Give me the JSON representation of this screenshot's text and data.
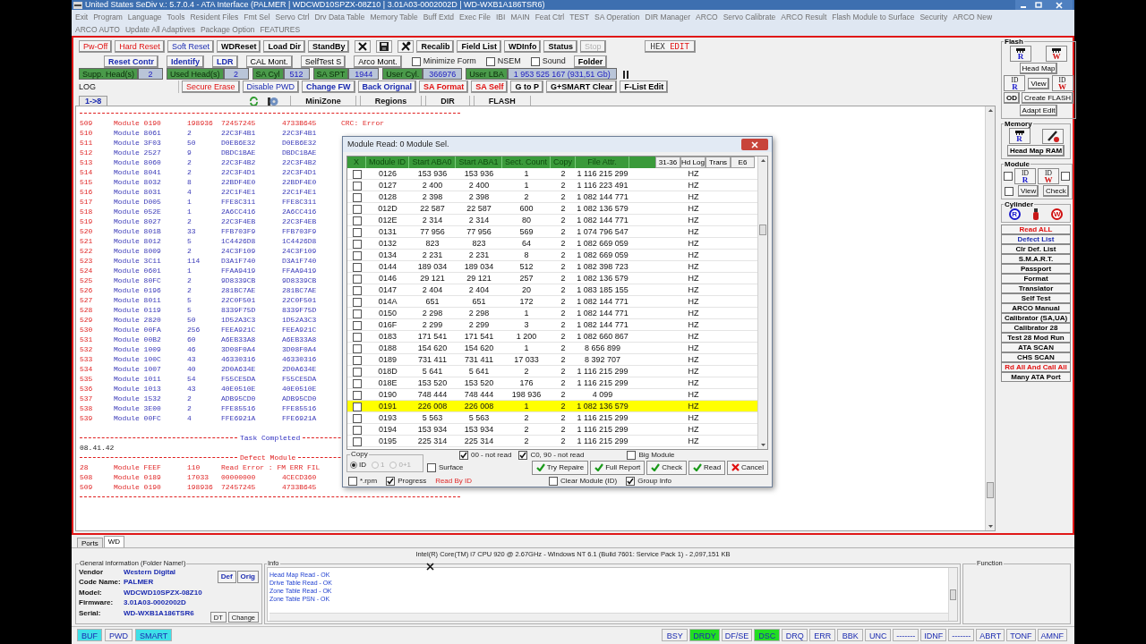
{
  "window": {
    "title": "United States  SeDiv v.: 5.7.0.4 - ATA Interface  (PALMER | WDCWD10SPZX-08Z10 | 3.01A03-0002002D | WD-WXB1A186TSR6)"
  },
  "menu": {
    "first_line": [
      "Exit",
      "Program",
      "Language",
      "Tools",
      "Resident Files",
      "Fmt Sel",
      "Servo Ctrl",
      "Drv Data Table",
      "Memory Table",
      "Buff Extd",
      "Exec File",
      "IBI",
      "MAIN",
      "Feat Ctrl",
      "TEST",
      "SA Operation",
      "DIR Manager",
      "ARCO",
      "Servo Calibrate",
      "ARCO Result",
      "Flash Module to Surface",
      "Security",
      "ARCO New"
    ],
    "second_line": [
      "ARCO AUTO",
      "Update All Adaptives",
      "Package Option",
      "FEATURES"
    ]
  },
  "toolbar": {
    "power_row": [
      {
        "kind": "alert-button",
        "label": "Pw-Off",
        "disabled": false
      },
      {
        "kind": "alert-button",
        "label": "Hard Reset",
        "disabled": false
      },
      {
        "kind": "accent-button",
        "label": "Soft Reset",
        "disabled": false
      },
      {
        "kind": "bold-button",
        "label": "WDReset",
        "disabled": false
      },
      {
        "kind": "bold-button",
        "label": "Load Dir",
        "disabled": false
      },
      {
        "kind": "bold-button",
        "label": "StandBy",
        "disabled": false
      },
      {
        "kind": "x-tool",
        "disabled": false
      },
      {
        "kind": "save-tool",
        "disabled": false
      },
      {
        "kind": "wrench-tool",
        "disabled": false
      },
      {
        "kind": "bold-button",
        "label": "Recalib",
        "disabled": false
      },
      {
        "kind": "bold-button",
        "label": "Field List",
        "disabled": false
      },
      {
        "kind": "bold-button",
        "label": "WDInfo",
        "disabled": false
      },
      {
        "kind": "bold-button",
        "label": "Status",
        "disabled": false
      },
      {
        "kind": "button",
        "label": "Stop",
        "disabled": true
      },
      {
        "kind": "hex",
        "parts": [
          "HEX",
          "EDIT"
        ],
        "disabled": false
      }
    ],
    "control_row": [
      {
        "kind": "bold-accent-button",
        "label": "Reset Contr"
      },
      {
        "kind": "bold-accent-button",
        "label": "Identify"
      },
      {
        "kind": "bold-accent-button",
        "label": "LDR"
      },
      {
        "kind": "button",
        "label": "CAL Mont."
      },
      {
        "kind": "button",
        "label": "SelfTest S"
      },
      {
        "kind": "button",
        "label": "Arco Mont."
      },
      {
        "kind": "check",
        "label": "Minimize Form",
        "checked": false
      },
      {
        "kind": "check",
        "label": "NSEM",
        "checked": false
      },
      {
        "kind": "check",
        "label": "Sound",
        "checked": false
      },
      {
        "kind": "bold-button",
        "label": "Folder"
      }
    ],
    "readout_row": [
      {
        "kind": "readout",
        "label": "Supp. Head(s)",
        "value": "2"
      },
      {
        "kind": "readout",
        "label": "Used Head(s)",
        "value": "2"
      },
      {
        "kind": "readout",
        "label": "SA Cyl",
        "value": "512"
      },
      {
        "kind": "readout",
        "label": "SA SPT",
        "value": "1944"
      },
      {
        "kind": "readout",
        "label": "User Cyl.",
        "value": "366976"
      },
      {
        "kind": "readout",
        "label": "User LBA",
        "value": "1 953 525 167  (931,51 Gb)"
      },
      {
        "kind": "splitter"
      }
    ],
    "log_row": [
      {
        "kind": "label",
        "text": "LOG"
      },
      {
        "kind": "alert-button",
        "label": "Secure Erase"
      },
      {
        "kind": "accent-button",
        "label": "Disable PWD"
      },
      {
        "kind": "bold-accent-button",
        "label": "Change FW"
      },
      {
        "kind": "bold-accent-button",
        "label": "Back Orignal"
      },
      {
        "kind": "bold-alert-button",
        "label": "SA Format"
      },
      {
        "kind": "bold-alert-button",
        "label": "SA Self"
      },
      {
        "kind": "bold-button",
        "label": "G to P"
      },
      {
        "kind": "bold-button",
        "label": "G+SMART Clear"
      },
      {
        "kind": "bold-button",
        "label": "F-List Edit"
      }
    ],
    "view_row": [
      {
        "kind": "tab",
        "label": "1->8"
      },
      {
        "kind": "refresh-tool"
      },
      {
        "kind": "disk-tool"
      },
      {
        "kind": "segment",
        "label": "MiniZone"
      },
      {
        "kind": "segment",
        "label": "Regions"
      },
      {
        "kind": "segment",
        "label": "DIR"
      },
      {
        "kind": "segment",
        "label": "FLASH"
      }
    ]
  },
  "log": {
    "lines": [
      {
        "kind": "rule"
      },
      {
        "kind": "error",
        "cells": [
          "509",
          "Module 0190",
          "198936",
          "72457245",
          "4733B645",
          "CRC: Error"
        ]
      },
      {
        "kind": "ok",
        "cells": [
          "510",
          "Module 8061",
          "2",
          "22C3F4B1",
          "22C3F4B1"
        ]
      },
      {
        "kind": "ok",
        "cells": [
          "511",
          "Module 3F03",
          "50",
          "D0EB6E32",
          "D0EB6E32"
        ]
      },
      {
        "kind": "ok",
        "cells": [
          "512",
          "Module 2527",
          "9",
          "DBDC1BAE",
          "DBDC1BAE"
        ]
      },
      {
        "kind": "ok",
        "cells": [
          "513",
          "Module 8060",
          "2",
          "22C3F4B2",
          "22C3F4B2"
        ]
      },
      {
        "kind": "ok",
        "cells": [
          "514",
          "Module 8041",
          "2",
          "22C3F4D1",
          "22C3F4D1"
        ]
      },
      {
        "kind": "ok",
        "cells": [
          "515",
          "Module 8032",
          "8",
          "22BDF4E0",
          "22BDF4E0"
        ]
      },
      {
        "kind": "ok",
        "cells": [
          "516",
          "Module 8031",
          "4",
          "22C1F4E1",
          "22C1F4E1"
        ]
      },
      {
        "kind": "ok",
        "cells": [
          "517",
          "Module D005",
          "1",
          "FFE8C311",
          "FFE8C311"
        ]
      },
      {
        "kind": "ok",
        "cells": [
          "518",
          "Module 052E",
          "1",
          "2A6CC416",
          "2A6CC416"
        ]
      },
      {
        "kind": "ok",
        "cells": [
          "519",
          "Module 8027",
          "2",
          "22C3F4EB",
          "22C3F4EB"
        ]
      },
      {
        "kind": "ok",
        "cells": [
          "520",
          "Module 801B",
          "33",
          "FFB703F9",
          "FFB703F9"
        ]
      },
      {
        "kind": "ok",
        "cells": [
          "521",
          "Module 8012",
          "5",
          "1C4426D8",
          "1C4426D8"
        ]
      },
      {
        "kind": "ok",
        "cells": [
          "522",
          "Module 8009",
          "2",
          "24C3F109",
          "24C3F109"
        ]
      },
      {
        "kind": "ok",
        "cells": [
          "523",
          "Module 3C11",
          "114",
          "D3A1F740",
          "D3A1F740"
        ]
      },
      {
        "kind": "ok",
        "cells": [
          "524",
          "Module 0601",
          "1",
          "FFAA9419",
          "FFAA9419"
        ]
      },
      {
        "kind": "ok",
        "cells": [
          "525",
          "Module 80FC",
          "2",
          "9D8339CB",
          "9D8339CB"
        ]
      },
      {
        "kind": "ok",
        "cells": [
          "526",
          "Module 0196",
          "2",
          "281BC7AE",
          "281BC7AE"
        ]
      },
      {
        "kind": "ok",
        "cells": [
          "527",
          "Module 8011",
          "5",
          "22C0F501",
          "22C0F501"
        ]
      },
      {
        "kind": "ok",
        "cells": [
          "528",
          "Module 0119",
          "5",
          "8339F75D",
          "8339F75D"
        ]
      },
      {
        "kind": "ok",
        "cells": [
          "529",
          "Module 2820",
          "50",
          "1D52A3C3",
          "1D52A3C3"
        ]
      },
      {
        "kind": "ok",
        "cells": [
          "530",
          "Module 00FA",
          "256",
          "FEEA921C",
          "FEEA921C"
        ]
      },
      {
        "kind": "ok",
        "cells": [
          "531",
          "Module 00B2",
          "60",
          "A6EB33A8",
          "A6EB33A8"
        ]
      },
      {
        "kind": "ok",
        "cells": [
          "532",
          "Module 1009",
          "46",
          "3D08F0A4",
          "3D08F0A4"
        ]
      },
      {
        "kind": "ok",
        "cells": [
          "533",
          "Module 100C",
          "43",
          "46330316",
          "46330316"
        ]
      },
      {
        "kind": "ok",
        "cells": [
          "534",
          "Module 1007",
          "40",
          "2D0A634E",
          "2D0A634E"
        ]
      },
      {
        "kind": "ok",
        "cells": [
          "535",
          "Module 1011",
          "54",
          "F55CE5DA",
          "F55CE5DA"
        ]
      },
      {
        "kind": "ok",
        "cells": [
          "536",
          "Module 1013",
          "43",
          "40E0510E",
          "40E0510E"
        ]
      },
      {
        "kind": "ok",
        "cells": [
          "537",
          "Module 1532",
          "2",
          "ADB95CD0",
          "ADB95CD0"
        ]
      },
      {
        "kind": "ok",
        "cells": [
          "538",
          "Module 3E00",
          "2",
          "FFE85516",
          "FFE85516"
        ]
      },
      {
        "kind": "ok",
        "cells": [
          "539",
          "Module 00FC",
          "4",
          "FFE6921A",
          "FFE6921A"
        ]
      },
      {
        "kind": "gap"
      },
      {
        "kind": "info-rule",
        "text": "Task Completed"
      },
      {
        "kind": "time",
        "text": "08.41.42"
      },
      {
        "kind": "alert-rule",
        "text": "Defect Module"
      },
      {
        "kind": "error",
        "cells": [
          "28",
          "Module FEEF",
          "110",
          "Read Error : FM ERR FIL"
        ]
      },
      {
        "kind": "error",
        "cells": [
          "508",
          "Module 0189",
          "17033",
          "00000000",
          "4CECD360"
        ]
      },
      {
        "kind": "error",
        "cells": [
          "509",
          "Module 0190",
          "198936",
          "72457245",
          "4733B645"
        ]
      },
      {
        "kind": "rule"
      }
    ]
  },
  "dialog": {
    "title": "Module Read: 0 Module Sel.",
    "check_column": "X",
    "columns": [
      "Module ID",
      "Start ABA0",
      "Start ABA1",
      "Sect. Count",
      "Copy",
      "File Attr."
    ],
    "header_tabs": [
      "31-36",
      "Hd Log",
      "Trans",
      "E6"
    ],
    "rows": [
      {
        "checked": false,
        "selected": false,
        "cells": [
          "0126",
          "153 936",
          "153 936",
          "1",
          "2",
          "1 116 215 299",
          "HZ"
        ]
      },
      {
        "checked": false,
        "selected": false,
        "cells": [
          "0127",
          "2 400",
          "2 400",
          "1",
          "2",
          "1 116 223 491",
          "HZ"
        ]
      },
      {
        "checked": false,
        "selected": false,
        "cells": [
          "0128",
          "2 398",
          "2 398",
          "2",
          "2",
          "1 082 144 771",
          "HZ"
        ]
      },
      {
        "checked": false,
        "selected": false,
        "cells": [
          "012D",
          "22 587",
          "22 587",
          "600",
          "2",
          "1 082 136 579",
          "HZ"
        ]
      },
      {
        "checked": false,
        "selected": false,
        "cells": [
          "012E",
          "2 314",
          "2 314",
          "80",
          "2",
          "1 082 144 771",
          "HZ"
        ]
      },
      {
        "checked": false,
        "selected": false,
        "cells": [
          "0131",
          "77 956",
          "77 956",
          "569",
          "2",
          "1 074 796 547",
          "HZ"
        ]
      },
      {
        "checked": false,
        "selected": false,
        "cells": [
          "0132",
          "823",
          "823",
          "64",
          "2",
          "1 082 669 059",
          "HZ"
        ]
      },
      {
        "checked": false,
        "selected": false,
        "cells": [
          "0134",
          "2 231",
          "2 231",
          "8",
          "2",
          "1 082 669 059",
          "HZ"
        ]
      },
      {
        "checked": false,
        "selected": false,
        "cells": [
          "0144",
          "189 034",
          "189 034",
          "512",
          "2",
          "1 082 398 723",
          "HZ"
        ]
      },
      {
        "checked": false,
        "selected": false,
        "cells": [
          "0146",
          "29 121",
          "29 121",
          "257",
          "2",
          "1 082 136 579",
          "HZ"
        ]
      },
      {
        "checked": false,
        "selected": false,
        "cells": [
          "0147",
          "2 404",
          "2 404",
          "20",
          "2",
          "1 083 185 155",
          "HZ"
        ]
      },
      {
        "checked": false,
        "selected": false,
        "cells": [
          "014A",
          "651",
          "651",
          "172",
          "2",
          "1 082 144 771",
          "HZ"
        ]
      },
      {
        "checked": false,
        "selected": false,
        "cells": [
          "0150",
          "2 298",
          "2 298",
          "1",
          "2",
          "1 082 144 771",
          "HZ"
        ]
      },
      {
        "checked": false,
        "selected": false,
        "cells": [
          "016F",
          "2 299",
          "2 299",
          "3",
          "2",
          "1 082 144 771",
          "HZ"
        ]
      },
      {
        "checked": false,
        "selected": false,
        "cells": [
          "0183",
          "171 541",
          "171 541",
          "1 200",
          "2",
          "1 082 660 867",
          "HZ"
        ]
      },
      {
        "checked": false,
        "selected": false,
        "cells": [
          "0188",
          "154 620",
          "154 620",
          "1",
          "2",
          "8 656 899",
          "HZ"
        ]
      },
      {
        "checked": false,
        "selected": false,
        "cells": [
          "0189",
          "731 411",
          "731 411",
          "17 033",
          "2",
          "8 392 707",
          "HZ"
        ]
      },
      {
        "checked": false,
        "selected": false,
        "cells": [
          "018D",
          "5 641",
          "5 641",
          "2",
          "2",
          "1 116 215 299",
          "HZ"
        ]
      },
      {
        "checked": false,
        "selected": false,
        "cells": [
          "018E",
          "153 520",
          "153 520",
          "176",
          "2",
          "1 116 215 299",
          "HZ"
        ]
      },
      {
        "checked": false,
        "selected": false,
        "cells": [
          "0190",
          "748 444",
          "748 444",
          "198 936",
          "2",
          "4 099",
          "HZ"
        ]
      },
      {
        "checked": false,
        "selected": true,
        "cells": [
          "0191",
          "226 008",
          "226 008",
          "1",
          "2",
          "1 082 136 579",
          "HZ"
        ]
      },
      {
        "checked": false,
        "selected": false,
        "cells": [
          "0193",
          "5 563",
          "5 563",
          "2",
          "2",
          "1 116 215 299",
          "HZ"
        ]
      },
      {
        "checked": false,
        "selected": false,
        "cells": [
          "0194",
          "153 934",
          "153 934",
          "2",
          "2",
          "1 116 215 299",
          "HZ"
        ]
      },
      {
        "checked": false,
        "selected": false,
        "cells": [
          "0195",
          "225 314",
          "225 314",
          "2",
          "2",
          "1 116 215 299",
          "HZ"
        ]
      }
    ],
    "copy_group": {
      "title": "Copy",
      "radios": [
        {
          "label": "ID",
          "selected": true,
          "disabled": false
        },
        {
          "label": "1",
          "selected": false,
          "disabled": true
        },
        {
          "label": "0+1",
          "selected": false,
          "disabled": true
        }
      ]
    },
    "top_checks": [
      {
        "label": "00 - not read",
        "checked": true
      },
      {
        "label": "C0, 90 - not read",
        "checked": true
      },
      {
        "label": "Big Module",
        "checked": false
      }
    ],
    "surface": {
      "label": "Surface",
      "checked": false
    },
    "buttons": [
      {
        "kind": "ok",
        "label": "Try Repaire"
      },
      {
        "kind": "ok",
        "label": "Full Report"
      },
      {
        "kind": "ok",
        "label": "Check"
      },
      {
        "kind": "ok",
        "label": "Read"
      },
      {
        "kind": "cancel",
        "label": "Cancel"
      }
    ],
    "bottom_checks": [
      {
        "label": "*.rpm",
        "checked": false
      },
      {
        "label": "Progress",
        "checked": true
      }
    ],
    "note": "Read By ID",
    "bottom_right_checks": [
      {
        "label": "Clear Module (ID)",
        "checked": false
      },
      {
        "label": "Group Info",
        "checked": true
      }
    ]
  },
  "side_panel": {
    "groups": [
      {
        "title": "Flash",
        "rows": [
          [
            {
              "kind": "read-chip",
              "letter": "R"
            },
            {
              "kind": "write-chip",
              "letter": "W"
            }
          ],
          [
            {
              "kind": "button",
              "label": "Head Map"
            }
          ],
          [
            {
              "kind": "read-id-chip",
              "caption": "ID",
              "letter": "R"
            },
            {
              "kind": "button",
              "label": "View"
            },
            {
              "kind": "write-id-chip",
              "caption": "ID",
              "letter": "W"
            }
          ],
          [
            {
              "kind": "strong-button",
              "label": "OD"
            },
            {
              "kind": "button",
              "label": "Create FLASH"
            }
          ],
          [
            {
              "kind": "button",
              "label": "Adapt Edit"
            }
          ]
        ]
      },
      {
        "title": "Memory",
        "rows": [
          [
            {
              "kind": "read-chip",
              "letter": "R"
            },
            {
              "kind": "tool"
            }
          ],
          [
            {
              "kind": "strong-button",
              "label": "Head Map RAM"
            }
          ]
        ]
      },
      {
        "title": "Module",
        "rows": [
          [
            {
              "kind": "check",
              "checked": false
            },
            {
              "kind": "read-id-chip",
              "caption": "ID",
              "letter": "R"
            },
            {
              "kind": "write-id-chip",
              "caption": "ID",
              "letter": "W"
            },
            {
              "kind": "check",
              "checked": false
            }
          ],
          [
            {
              "kind": "check",
              "checked": false
            },
            {
              "kind": "button",
              "label": "View"
            },
            {
              "kind": "button",
              "label": "Check"
            }
          ]
        ]
      },
      {
        "title": "Cylinder",
        "rows": [
          [
            {
              "kind": "read-circle",
              "letter": "R"
            },
            {
              "kind": "capsule"
            },
            {
              "kind": "write-circle",
              "letter": "W"
            }
          ]
        ]
      }
    ],
    "actions": [
      {
        "kind": "alert-action",
        "label": "Read ALL"
      },
      {
        "kind": "accent-action",
        "label": "Defect List"
      },
      {
        "kind": "action",
        "label": "Clr Def. List"
      },
      {
        "kind": "action",
        "label": "S.M.A.R.T."
      },
      {
        "kind": "action",
        "label": "Passport"
      },
      {
        "kind": "action",
        "label": "Format"
      },
      {
        "kind": "action",
        "label": "Translator"
      },
      {
        "kind": "action",
        "label": "Self Test"
      },
      {
        "kind": "action",
        "label": "ARCO Manual"
      },
      {
        "kind": "action",
        "label": "Calibrator (SA,UA)"
      },
      {
        "kind": "action",
        "label": "Calibrator 28"
      },
      {
        "kind": "action",
        "label": "Test 28 Mod Run"
      },
      {
        "kind": "action",
        "label": "ATA SCAN"
      },
      {
        "kind": "action",
        "label": "CHS SCAN"
      },
      {
        "kind": "alert-action",
        "label": "Rd All And Call All"
      },
      {
        "kind": "action",
        "label": "Many ATA Port"
      }
    ]
  },
  "bottom_tabs": [
    {
      "label": "Ports",
      "selected": false
    },
    {
      "label": "WD",
      "selected": true
    }
  ],
  "system_info": "Intel(R) Core(TM) i7 CPU 920  @ 2.67GHz - Windows NT 6.1 (Build 7601: Service Pack 1) -  2,097,151 KB",
  "general_info": {
    "title": "General information (Folder Name!)",
    "fields": [
      {
        "label": "Vendor",
        "value": "Western Digital"
      },
      {
        "label": "Code Name:",
        "value": "PALMER"
      },
      {
        "label": "Model:",
        "value": "WDCWD10SPZX-08Z10"
      },
      {
        "label": "Firmware:",
        "value": "3.01A03-0002002D"
      },
      {
        "label": "Serial:",
        "value": "WD-WXB1A186TSR6"
      }
    ],
    "top_buttons": [
      "Def",
      "Orig"
    ],
    "bottom_buttons": [
      "DT",
      "Change"
    ]
  },
  "info": {
    "title": "Info",
    "lines": [
      "Head Map Read - OK",
      "Drive Table Read - OK",
      "Zone Table Read - OK",
      "Zone Table PSN - OK"
    ]
  },
  "function_panel": {
    "title": "Function"
  },
  "status_bar": {
    "modes": [
      {
        "label": "BUF",
        "on": true
      },
      {
        "label": "PWD",
        "on": false
      },
      {
        "label": "SMART",
        "on": true
      }
    ],
    "registers": [
      {
        "label": "BSY",
        "on": false
      },
      {
        "label": "DRDY",
        "on": true
      },
      {
        "label": "DF/SE",
        "on": false
      },
      {
        "label": "DSC",
        "on": true
      },
      {
        "label": "DRQ",
        "on": false
      },
      {
        "label": "ERR",
        "on": false
      },
      {
        "label": "BBK",
        "on": false
      },
      {
        "label": "UNC",
        "on": false
      },
      {
        "label": "-------",
        "on": false
      },
      {
        "label": "IDNF",
        "on": false
      },
      {
        "label": "-------",
        "on": false
      },
      {
        "label": "ABRT",
        "on": false
      },
      {
        "label": "TONF",
        "on": false
      },
      {
        "label": "AMNF",
        "on": false
      }
    ]
  }
}
